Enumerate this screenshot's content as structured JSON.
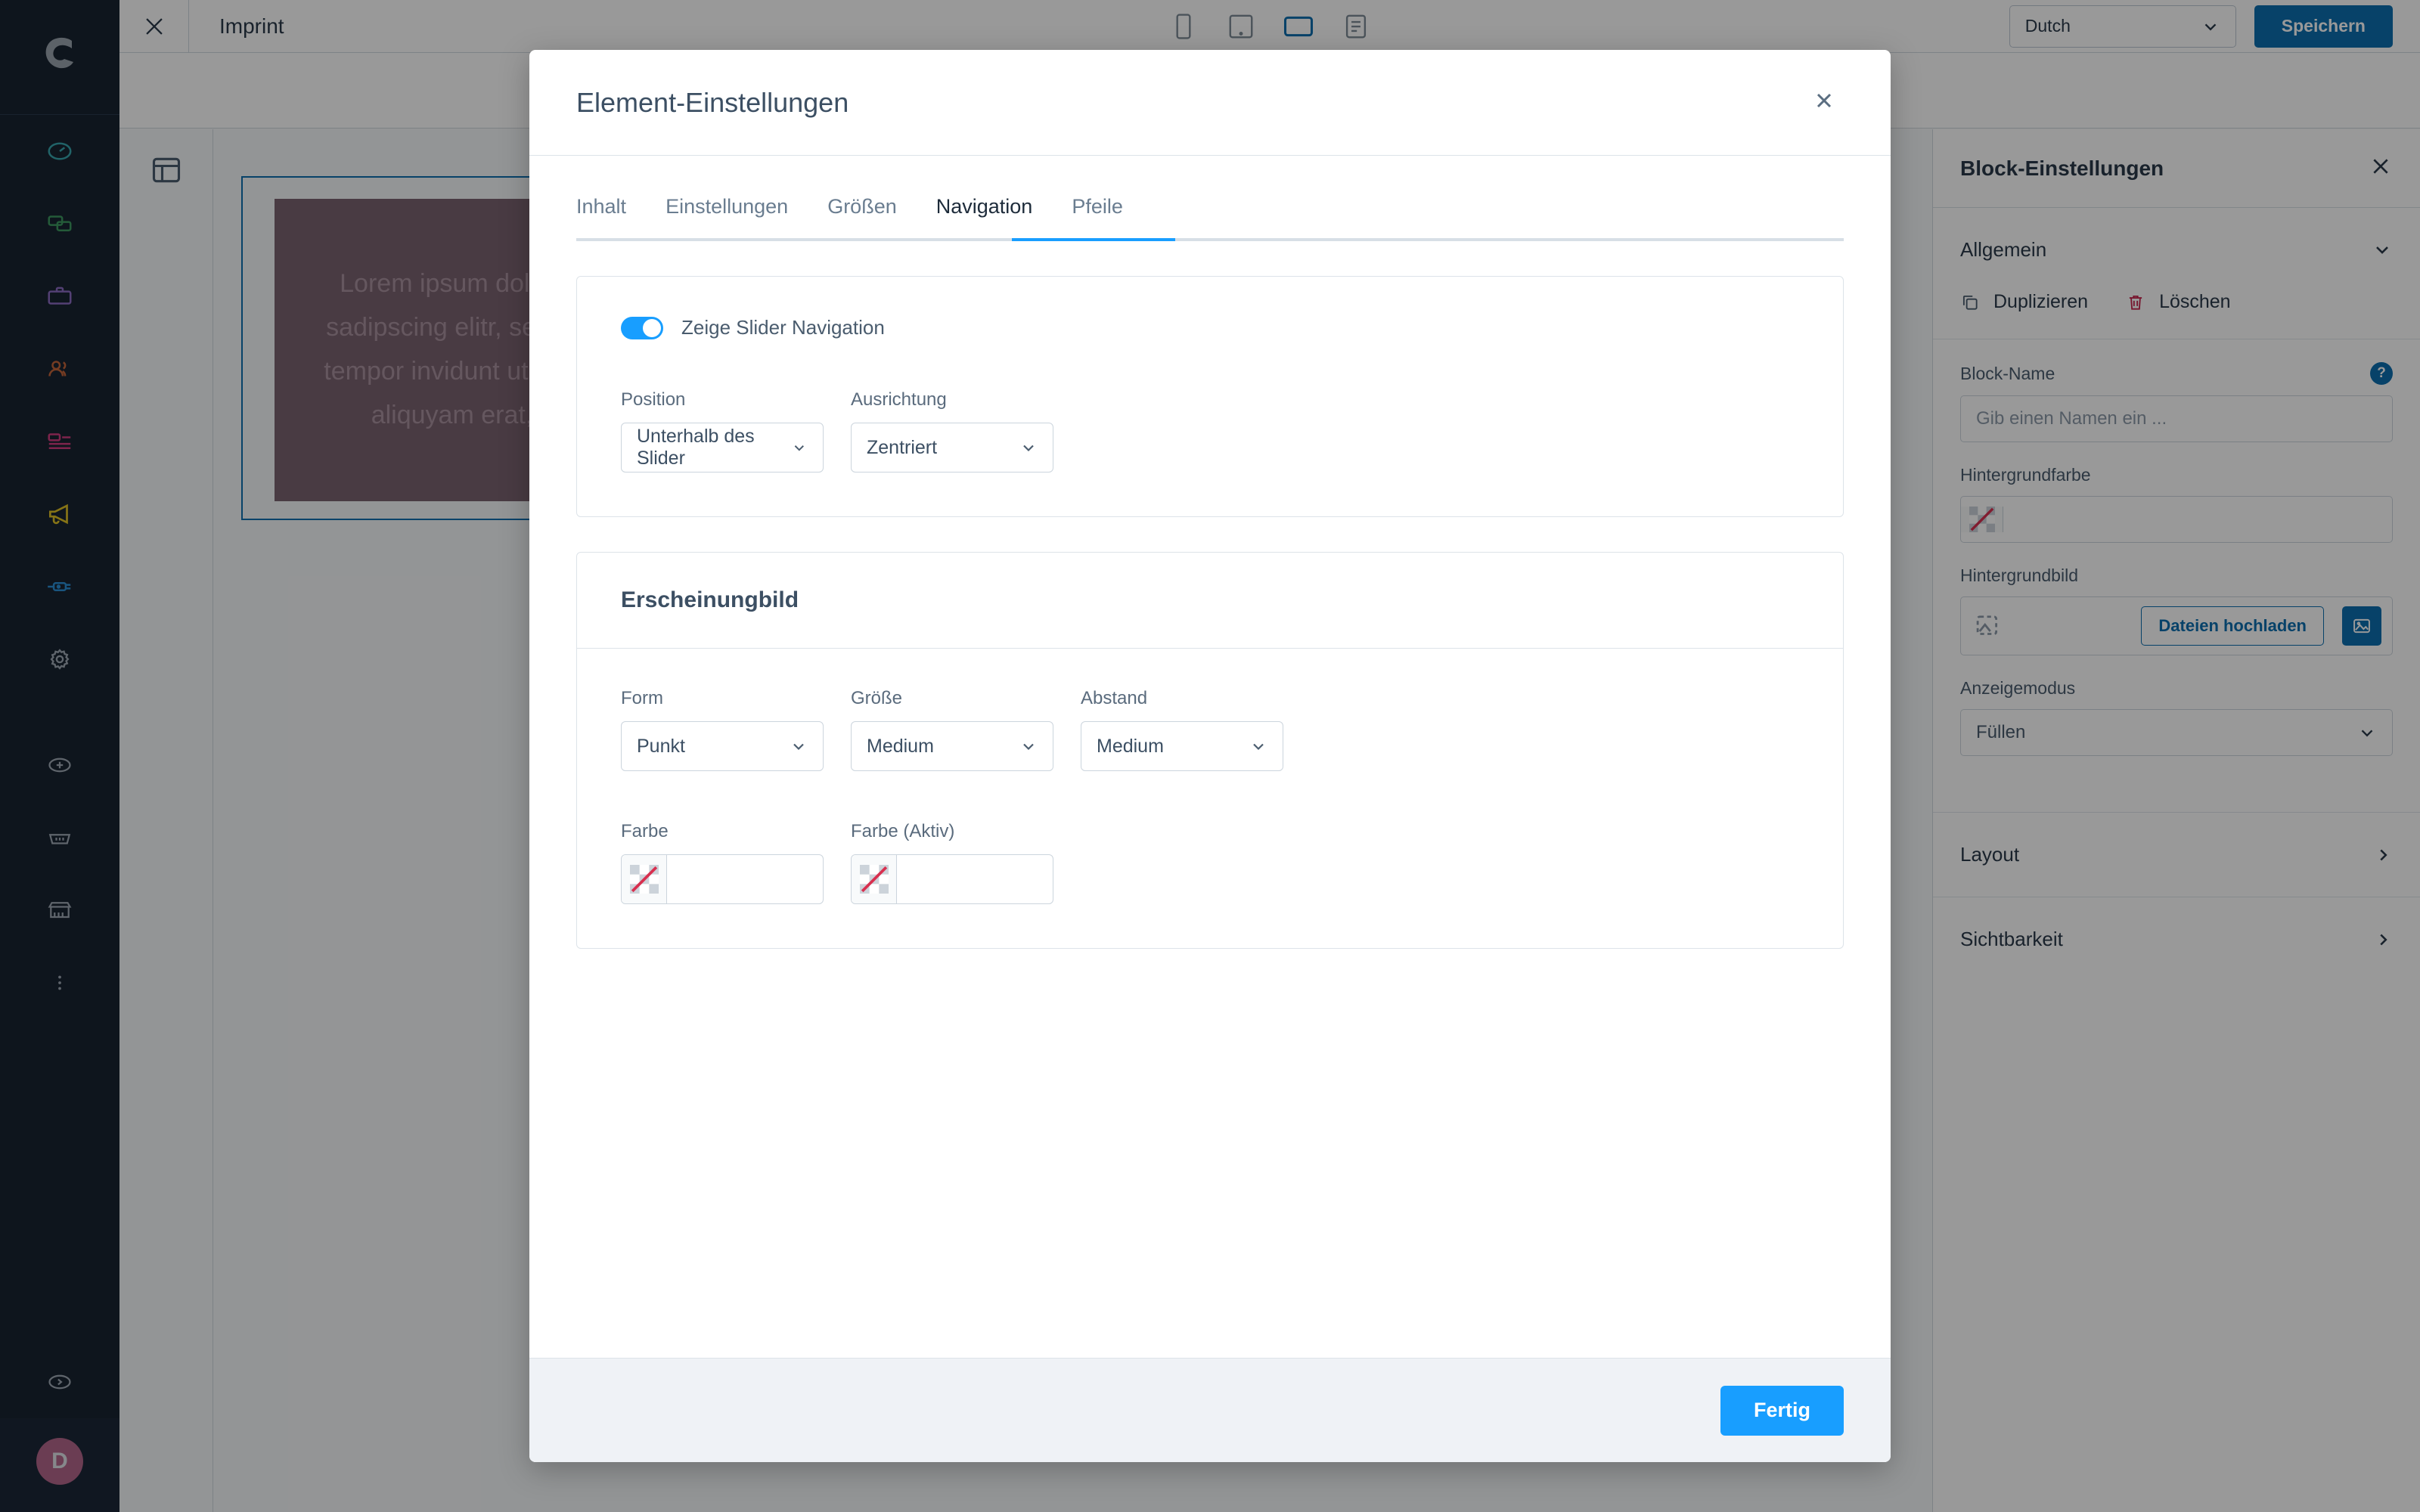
{
  "app": {
    "topbar": {
      "close_icon": "close-icon",
      "page_title": "Imprint",
      "devices": [
        {
          "name": "mobile",
          "active": false
        },
        {
          "name": "tablet",
          "active": false
        },
        {
          "name": "desktop",
          "active": true
        },
        {
          "name": "form-view",
          "active": false
        }
      ],
      "language": "Dutch",
      "save_label": "Speichern"
    },
    "rail": {
      "logo": "shopware-logo",
      "items": [
        {
          "name": "dashboard-icon",
          "color": "#37a5ad"
        },
        {
          "name": "catalogues-icon",
          "color": "#3c9860"
        },
        {
          "name": "orders-icon",
          "color": "#8a6cc1"
        },
        {
          "name": "customers-icon",
          "color": "#c4643a"
        },
        {
          "name": "content-icon",
          "color": "#d13c7f"
        },
        {
          "name": "marketing-icon",
          "color": "#e0c126"
        },
        {
          "name": "extensions-icon",
          "color": "#2a8ed4"
        },
        {
          "name": "settings-icon",
          "color": "#9fa9b4"
        }
      ],
      "bottom_items": [
        {
          "name": "add-circle-icon"
        },
        {
          "name": "basket-icon"
        },
        {
          "name": "store-icon"
        },
        {
          "name": "more-icon"
        }
      ],
      "expand_icon": "expand-chevron-icon",
      "avatar_initial": "D",
      "avatar_color": "#b3668a"
    },
    "cms_sidebar": {
      "section_icon": "layout-sections-icon"
    },
    "stage": {
      "slider_placeholder_text": "Lorem ipsum dolor sit amet, consetetur sadipscing elitr, sed diam nonumy eirmod tempor invidunt ut labore et dolore magna aliquyam erat, sed diam hendrerit"
    },
    "right_panel": {
      "title": "Block-Einstellungen",
      "close_icon": "close-icon",
      "accordion_title": "Allgemein",
      "chevron_icon": "chevron-down-icon",
      "duplicate_label": "Duplizieren",
      "duplicate_icon": "duplicate-icon",
      "delete_label": "Löschen",
      "delete_icon": "trash-icon",
      "block_name_label": "Block-Name",
      "block_name_placeholder": "Gib einen Namen ein ...",
      "help_icon": "?",
      "bg_color_label": "Hintergrundfarbe",
      "bg_color_value": "",
      "bg_image_label": "Hintergrundbild",
      "upload_label": "Dateien hochladen",
      "upload_icon": "image-icon",
      "display_mode_label": "Anzeigemodus",
      "display_mode_value": "Füllen",
      "layout_label": "Layout",
      "visibility_label": "Sichtbarkeit",
      "chevron_right_icon": "chevron-right-icon"
    }
  },
  "modal": {
    "title": "Element-Einstellungen",
    "close_icon": "close-icon",
    "tabs": [
      {
        "label": "Inhalt",
        "active": false
      },
      {
        "label": "Einstellungen",
        "active": false
      },
      {
        "label": "Größen",
        "active": false
      },
      {
        "label": "Navigation",
        "active": true
      },
      {
        "label": "Pfeile",
        "active": false
      }
    ],
    "navigation_panel": {
      "toggle_label": "Zeige Slider Navigation",
      "toggle_on": true,
      "fields": [
        {
          "label": "Position",
          "value": "Unterhalb des Slider"
        },
        {
          "label": "Ausrichtung",
          "value": "Zentriert"
        }
      ]
    },
    "appearance_panel": {
      "heading": "Erscheinungbild",
      "row1": [
        {
          "label": "Form",
          "value": "Punkt"
        },
        {
          "label": "Größe",
          "value": "Medium"
        },
        {
          "label": "Abstand",
          "value": "Medium"
        }
      ],
      "row2": [
        {
          "label": "Farbe",
          "value": ""
        },
        {
          "label": "Farbe (Aktiv)",
          "value": ""
        }
      ]
    },
    "footer": {
      "done_label": "Fertig"
    }
  },
  "colors": {
    "accent_blue": "#189eff",
    "save_blue": "#0c6eb0",
    "rail_dark": "#182331",
    "delete_red": "#c7254e",
    "slider_placeholder": "#7b6370"
  }
}
